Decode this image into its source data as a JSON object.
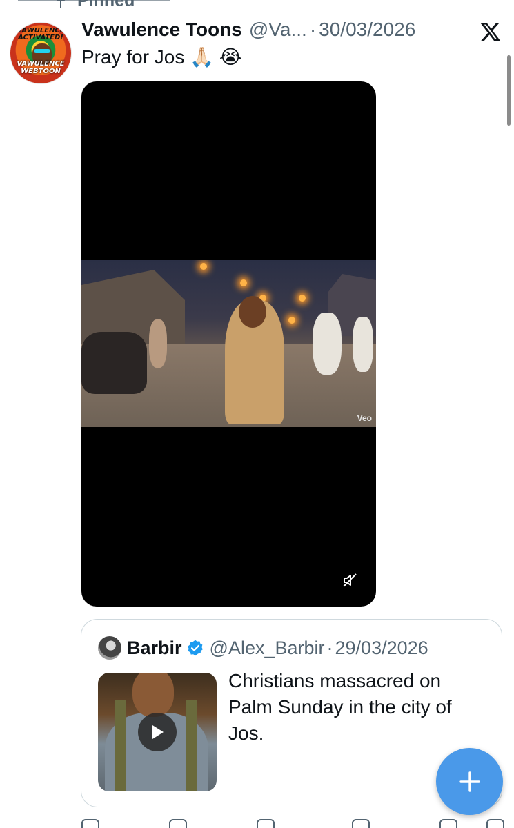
{
  "pinned": {
    "label": "Pinned"
  },
  "tweet": {
    "display_name": "Vawulence Toons",
    "handle": "@Va...",
    "separator": "·",
    "date": "30/03/2026",
    "text": "Pray for Jos 🙏🏻 😭",
    "avatar": {
      "line1": "VAWULENCE ACTIVATED!",
      "line2": "VAWULENCE WEBTOON"
    },
    "media": {
      "watermark": "Veo"
    }
  },
  "quote": {
    "display_name": "Barbir",
    "handle": "@Alex_Barbir",
    "separator": "·",
    "date": "29/03/2026",
    "text": "Christians massacred on Palm Sunday in the city of Jos."
  },
  "colors": {
    "fab": "#4a99e9",
    "verified": "#1d9bf0",
    "secondary_text": "#536471"
  },
  "icons": [
    "pin-icon",
    "x-logo-icon",
    "mute-icon",
    "verified-badge-icon",
    "play-icon",
    "plus-icon"
  ]
}
